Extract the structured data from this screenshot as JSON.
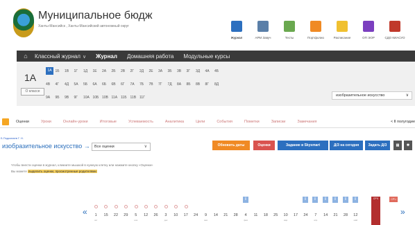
{
  "header": {
    "title": "Муниципальное бюджетное общ",
    "subtitle": "Ханты-Мансийск , Ханты-Мансийский автономный округ",
    "apps": [
      {
        "label": "Журнал",
        "icon": "journal-icon",
        "color": "#2c6fbf"
      },
      {
        "label": "АРМ Завуч",
        "icon": "arm-icon",
        "color": "#5a7fa8"
      },
      {
        "label": "Тесты",
        "icon": "tests-icon",
        "color": "#6aa84f"
      },
      {
        "label": "Портфолио",
        "icon": "portfolio-icon",
        "color": "#f08a24"
      },
      {
        "label": "Расписание",
        "icon": "schedule-icon",
        "color": "#f0c030"
      },
      {
        "label": "ОП ЭОР",
        "icon": "eor-icon",
        "color": "#7b3fbf"
      },
      {
        "label": "СДО КИАСУО",
        "icon": "sdo-icon",
        "color": "#c0392b"
      }
    ]
  },
  "nav": {
    "items": [
      {
        "label": "Классный журнал",
        "has_chevron": true
      },
      {
        "label": "Журнал",
        "current": true
      },
      {
        "label": "Домашняя работа"
      },
      {
        "label": "Модульные курсы"
      }
    ]
  },
  "classes": {
    "current": "1А",
    "button_label": "О классе",
    "rows": [
      [
        "1А",
        "1Б",
        "1В",
        "1Г",
        "1Д",
        "1Е",
        "2А",
        "2Б",
        "2В",
        "2Г",
        "2Д",
        "2Е",
        "3А",
        "3Б",
        "3В",
        "3Г",
        "3Д",
        "4А",
        "4Б"
      ],
      [
        "4В",
        "4Г",
        "4Д",
        "5А",
        "5Б",
        "6А",
        "6Б",
        "6В",
        "6Г",
        "7А",
        "7Б",
        "7В",
        "7Г",
        "7Д",
        "8А",
        "8Б",
        "8В",
        "8Г",
        "8Д"
      ],
      [
        "9А",
        "9Б",
        "9В",
        "9Г",
        "10А",
        "10Б",
        "10В",
        "11А",
        "11Б",
        "11В",
        "11Г"
      ]
    ],
    "subject_select": "изобразительное искусство"
  },
  "tabs": {
    "items": [
      "Оценки",
      "Уроки",
      "Онлайн-уроки",
      "Итоговые",
      "Успеваемость",
      "Аналитика",
      "Цели",
      "События",
      "Пометки",
      "Записки",
      "Замечания"
    ],
    "active": "Оценки",
    "period": "< Ⅱ полугодие"
  },
  "toolbar": {
    "teacher": "Б.Подкопаев Г. Н.",
    "subject": "изобразительное искусство →",
    "grades_select": "Все оценки",
    "btn_update": "Обновить даты",
    "btn_grades": "Оценки",
    "btn_skysmart": "Задание в Skysmart",
    "btn_today": "Д/З на сегодня",
    "btn_hw": "Задать Д/З"
  },
  "hints": {
    "line1": "Чтобы внести оценки в журнал, кликните мышкой в нужную клетку или нажмите кнопку «Оценки»",
    "line2_prefix": "Вы можете ",
    "line2_highlight": "выделить оценки, просмотренные родителями"
  },
  "timeline": {
    "prev": "«",
    "next": "»",
    "days": [
      {
        "d": "1",
        "m": "окт"
      },
      {
        "d": "15",
        "m": ""
      },
      {
        "d": "22",
        "m": ""
      },
      {
        "d": "29",
        "m": ""
      },
      {
        "d": "5",
        "m": "ноя"
      },
      {
        "d": "12",
        "m": ""
      },
      {
        "d": "26",
        "m": ""
      },
      {
        "d": "3",
        "m": "дек"
      },
      {
        "d": "10",
        "m": ""
      },
      {
        "d": "17",
        "m": ""
      },
      {
        "d": "24",
        "m": ""
      },
      {
        "d": "9",
        "m": "янв"
      },
      {
        "d": "14",
        "m": ""
      },
      {
        "d": "21",
        "m": ""
      },
      {
        "d": "28",
        "m": ""
      },
      {
        "d": "4",
        "m": "фев"
      },
      {
        "d": "11",
        "m": ""
      },
      {
        "d": "18",
        "m": ""
      },
      {
        "d": "25",
        "m": ""
      },
      {
        "d": "10",
        "m": "мар"
      },
      {
        "d": "17",
        "m": ""
      },
      {
        "d": "24",
        "m": ""
      },
      {
        "d": "7",
        "m": "апр"
      },
      {
        "d": "14",
        "m": ""
      },
      {
        "d": "21",
        "m": ""
      },
      {
        "d": "28",
        "m": ""
      },
      {
        "d": "12",
        "m": "май"
      }
    ],
    "info_mark": "i",
    "red_label": "СРЧ",
    "red_label2": "СРЧ"
  }
}
